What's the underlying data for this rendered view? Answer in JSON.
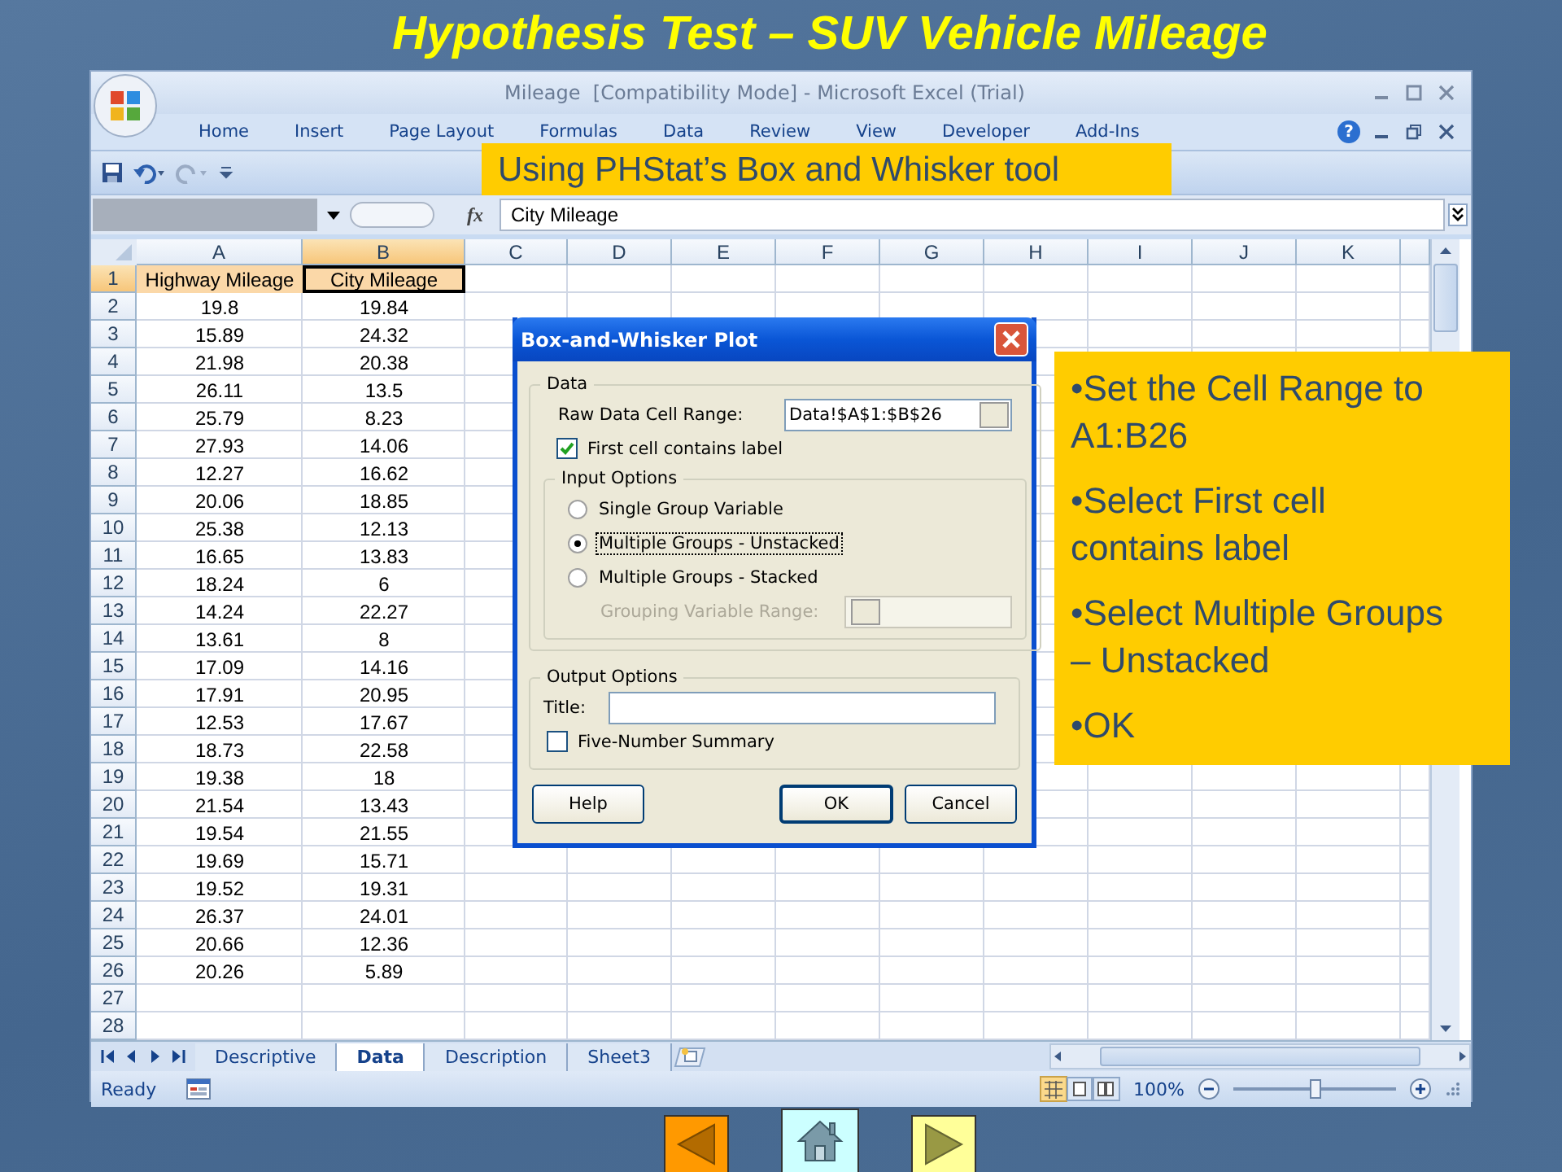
{
  "slide": {
    "title": "Hypothesis Test – SUV Vehicle Mileage"
  },
  "excel": {
    "window_title": "Mileage  [Compatibility Mode] - Microsoft Excel (Trial)",
    "ribbon_tabs": [
      "Home",
      "Insert",
      "Page Layout",
      "Formulas",
      "Data",
      "Review",
      "View",
      "Developer",
      "Add-Ins"
    ],
    "help_glyph": "?",
    "function_label": "fx",
    "formula": "City Mileage",
    "columns": [
      {
        "label": "A",
        "selected": false
      },
      {
        "label": "B",
        "selected": true
      },
      {
        "label": "C",
        "selected": false
      },
      {
        "label": "D",
        "selected": false
      },
      {
        "label": "E",
        "selected": false
      },
      {
        "label": "F",
        "selected": false
      },
      {
        "label": "G",
        "selected": false
      },
      {
        "label": "H",
        "selected": false
      },
      {
        "label": "I",
        "selected": false
      },
      {
        "label": "J",
        "selected": false
      },
      {
        "label": "K",
        "selected": false
      }
    ],
    "rows": [
      {
        "label": "1",
        "selected": true,
        "cells": [
          "Highway Mileage",
          "City Mileage"
        ]
      },
      {
        "label": "2",
        "selected": false,
        "cells": [
          "19.8",
          "19.84"
        ]
      },
      {
        "label": "3",
        "selected": false,
        "cells": [
          "15.89",
          "24.32"
        ]
      },
      {
        "label": "4",
        "selected": false,
        "cells": [
          "21.98",
          "20.38"
        ]
      },
      {
        "label": "5",
        "selected": false,
        "cells": [
          "26.11",
          "13.5"
        ]
      },
      {
        "label": "6",
        "selected": false,
        "cells": [
          "25.79",
          "8.23"
        ]
      },
      {
        "label": "7",
        "selected": false,
        "cells": [
          "27.93",
          "14.06"
        ]
      },
      {
        "label": "8",
        "selected": false,
        "cells": [
          "12.27",
          "16.62"
        ]
      },
      {
        "label": "9",
        "selected": false,
        "cells": [
          "20.06",
          "18.85"
        ]
      },
      {
        "label": "10",
        "selected": false,
        "cells": [
          "25.38",
          "12.13"
        ]
      },
      {
        "label": "11",
        "selected": false,
        "cells": [
          "16.65",
          "13.83"
        ]
      },
      {
        "label": "12",
        "selected": false,
        "cells": [
          "18.24",
          "6"
        ]
      },
      {
        "label": "13",
        "selected": false,
        "cells": [
          "14.24",
          "22.27"
        ]
      },
      {
        "label": "14",
        "selected": false,
        "cells": [
          "13.61",
          "8"
        ]
      },
      {
        "label": "15",
        "selected": false,
        "cells": [
          "17.09",
          "14.16"
        ]
      },
      {
        "label": "16",
        "selected": false,
        "cells": [
          "17.91",
          "20.95"
        ]
      },
      {
        "label": "17",
        "selected": false,
        "cells": [
          "12.53",
          "17.67"
        ]
      },
      {
        "label": "18",
        "selected": false,
        "cells": [
          "18.73",
          "22.58"
        ]
      },
      {
        "label": "19",
        "selected": false,
        "cells": [
          "19.38",
          "18"
        ]
      },
      {
        "label": "20",
        "selected": false,
        "cells": [
          "21.54",
          "13.43"
        ]
      },
      {
        "label": "21",
        "selected": false,
        "cells": [
          "19.54",
          "21.55"
        ]
      },
      {
        "label": "22",
        "selected": false,
        "cells": [
          "19.69",
          "15.71"
        ]
      },
      {
        "label": "23",
        "selected": false,
        "cells": [
          "19.52",
          "19.31"
        ]
      },
      {
        "label": "24",
        "selected": false,
        "cells": [
          "26.37",
          "24.01"
        ]
      },
      {
        "label": "25",
        "selected": false,
        "cells": [
          "20.66",
          "12.36"
        ]
      },
      {
        "label": "26",
        "selected": false,
        "cells": [
          "20.26",
          "5.89"
        ]
      },
      {
        "label": "27",
        "selected": false
      },
      {
        "label": "28",
        "selected": false
      }
    ],
    "sheet_tabs": [
      {
        "label": "Descriptive",
        "selected": false
      },
      {
        "label": "Data",
        "selected": true
      },
      {
        "label": "Description",
        "selected": false
      },
      {
        "label": "Sheet3",
        "selected": false
      }
    ],
    "status": "Ready",
    "zoom": {
      "reading": "100%",
      "level": 0.5
    }
  },
  "caption": "Using PHStat’s Box and Whisker tool",
  "dialog": {
    "title": "Box-and-Whisker Plot",
    "data_group": {
      "legend": "Data",
      "range_label": "Raw Data Cell Range:",
      "range_value": "Data!$A$1:$B$26",
      "label_checkbox": {
        "label": "First cell contains label",
        "checked": true
      }
    },
    "input_group": {
      "legend": "Input Options",
      "options": [
        {
          "label": "Single Group Variable",
          "selected": false
        },
        {
          "label": "Multiple Groups - Unstacked",
          "selected": true
        },
        {
          "label": "Multiple Groups - Stacked",
          "selected": false
        }
      ],
      "grouping_label": "Grouping Variable Range:",
      "grouping_disabled": true
    },
    "output_group": {
      "legend": "Output Options",
      "title_label": "Title:",
      "summary_checkbox": {
        "label": "Five-Number Summary",
        "checked": false
      }
    },
    "buttons": [
      "Help",
      "OK",
      "Cancel"
    ]
  },
  "notes": [
    "•Set the Cell Range to A1:B26",
    "•Select First cell contains label",
    "•Select Multiple Groups – Unstacked",
    "•OK"
  ],
  "nav_buttons": [
    {
      "kind": "prev"
    },
    {
      "kind": "home"
    },
    {
      "kind": "next"
    }
  ]
}
